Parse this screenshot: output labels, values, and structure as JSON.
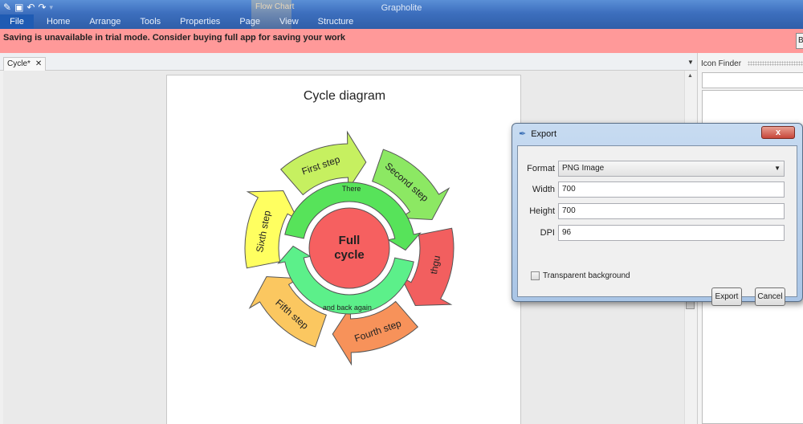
{
  "app": {
    "title": "Grapholite",
    "context_tab_group": "Flow Chart"
  },
  "ribbon": {
    "tabs": [
      "File",
      "Home",
      "Arrange",
      "Tools",
      "Properties",
      "Page",
      "View",
      "Structure"
    ]
  },
  "banner": {
    "message": "Saving is unavailable in trial mode. Consider buying full app for saving your work",
    "button_label": "B"
  },
  "document": {
    "tab_label": "Cycle*",
    "close_glyph": "✕"
  },
  "diagram": {
    "title": "Cycle diagram",
    "center_line1": "Full",
    "center_line2": "cycle",
    "segments": [
      {
        "label": "First step",
        "color": "#c6f060"
      },
      {
        "label": "Second step",
        "color": "#8ce863"
      },
      {
        "label": "thgu",
        "color": "#f25f5f"
      },
      {
        "label": "Fourth step",
        "color": "#f7925a"
      },
      {
        "label": "Fifth step",
        "color": "#fbc760"
      },
      {
        "label": "Sixth step",
        "color": "#ffff60"
      }
    ],
    "inner_top_label": "There",
    "inner_bottom_label": "and back again",
    "inner_top_color": "#57e35a",
    "inner_bottom_color": "#5cf08a",
    "center_color": "#f66060"
  },
  "icon_finder": {
    "title": "Icon Finder"
  },
  "export_dialog": {
    "title": "Export",
    "close_glyph": "x",
    "format_label": "Format",
    "format_value": "PNG Image",
    "width_label": "Width",
    "width_value": "700",
    "height_label": "Height",
    "height_value": "700",
    "dpi_label": "DPI",
    "dpi_value": "96",
    "transparent_label": "Transparent background",
    "export_button": "Export",
    "cancel_button": "Cancel"
  }
}
